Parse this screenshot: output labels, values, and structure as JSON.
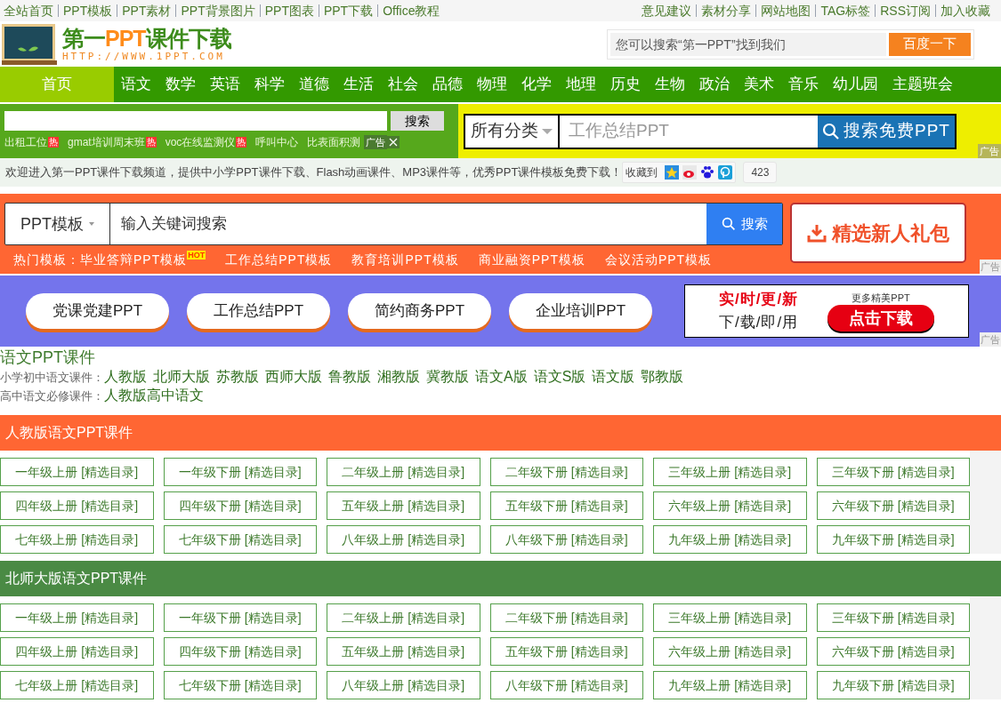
{
  "top_bar": {
    "left_links": [
      "全站首页",
      "PPT模板",
      "PPT素材",
      "PPT背景图片",
      "PPT图表",
      "PPT下载",
      "Office教程"
    ],
    "right_links": [
      "意见建议",
      "素材分享",
      "网站地图",
      "TAG标签",
      "RSS订阅",
      "加入收藏"
    ]
  },
  "header": {
    "logo_title_parts": [
      "第一",
      "PPT",
      "课件下载"
    ],
    "logo_url": "HTTP://WWW.1PPT.COM",
    "search_placeholder": "您可以搜索“第一PPT”找到我们",
    "search_button": "百度一下"
  },
  "nav": [
    {
      "label": "首页",
      "selected": true
    },
    {
      "label": "语文",
      "selected": false
    },
    {
      "label": "数学",
      "selected": false
    },
    {
      "label": "英语",
      "selected": false
    },
    {
      "label": "科学",
      "selected": false
    },
    {
      "label": "道德",
      "selected": false
    },
    {
      "label": "生活",
      "selected": false
    },
    {
      "label": "社会",
      "selected": false
    },
    {
      "label": "品德",
      "selected": false
    },
    {
      "label": "物理",
      "selected": false
    },
    {
      "label": "化学",
      "selected": false
    },
    {
      "label": "地理",
      "selected": false
    },
    {
      "label": "历史",
      "selected": false
    },
    {
      "label": "生物",
      "selected": false
    },
    {
      "label": "政治",
      "selected": false
    },
    {
      "label": "美术",
      "selected": false
    },
    {
      "label": "音乐",
      "selected": false
    },
    {
      "label": "幼儿园",
      "selected": false
    },
    {
      "label": "主题班会",
      "selected": false
    }
  ],
  "ad_left": {
    "search_button": "搜索",
    "links": [
      {
        "label": "出租工位",
        "badge": "热"
      },
      {
        "label": "gmat培训周末班",
        "badge": "热"
      },
      {
        "label": "voc在线监测仪",
        "badge": "热"
      },
      {
        "label": "呼叫中心"
      },
      {
        "label": "比表面积测"
      }
    ],
    "ad_label": "广告"
  },
  "ad_right": {
    "category": "所有分类",
    "placeholder": "工作总结PPT",
    "button": "搜索免费PPT",
    "ad_label": "广告"
  },
  "welcome": {
    "text": "欢迎进入第一PPT课件下载频道，提供中小学PPT课件下载、Flash动画课件、MP3课件等，优秀PPT课件模板免费下载！",
    "bookmark_label": "收藏到",
    "count": "423"
  },
  "template_banner": {
    "category": "PPT模板",
    "placeholder": "输入关键词搜索",
    "button": "搜索",
    "gift_button": "精选新人礼包",
    "hot_label": "热门模板：",
    "hot_links": [
      {
        "label": "毕业答辩PPT模板",
        "badge": "HOT"
      },
      {
        "label": "工作总结PPT模板"
      },
      {
        "label": "教育培训PPT模板"
      },
      {
        "label": "商业融资PPT模板"
      },
      {
        "label": "会议活动PPT模板"
      }
    ],
    "ad_label": "广告"
  },
  "promo_banner": {
    "pills": [
      "党课党建PPT",
      "工作总结PPT",
      "简约商务PPT",
      "企业培训PPT"
    ],
    "slogan_top": "实/时/更/新",
    "slogan_bottom": "下/载/即/用",
    "more_label": "更多精美PPT",
    "download_button": "点击下载",
    "ad_label": "广告"
  },
  "subject": {
    "title": "语文PPT课件",
    "rows": [
      {
        "label": "小学初中语文课件：",
        "links": [
          "人教版",
          "北师大版",
          "苏教版",
          "西师大版",
          "鲁教版",
          "湘教版",
          "冀教版",
          "语文A版",
          "语文S版",
          "语文版",
          "鄂教版"
        ]
      },
      {
        "label": "高中语文必修课件：",
        "links": [
          "人教版高中语文"
        ]
      }
    ]
  },
  "sections": [
    {
      "title": "人教版语文PPT课件",
      "color": "#ff6633",
      "items": [
        "一年级上册 [精选目录]",
        "一年级下册 [精选目录]",
        "二年级上册 [精选目录]",
        "二年级下册 [精选目录]",
        "三年级上册 [精选目录]",
        "三年级下册 [精选目录]",
        "四年级上册 [精选目录]",
        "四年级下册 [精选目录]",
        "五年级上册 [精选目录]",
        "五年级下册 [精选目录]",
        "六年级上册 [精选目录]",
        "六年级下册 [精选目录]",
        "七年级上册 [精选目录]",
        "七年级下册 [精选目录]",
        "八年级上册 [精选目录]",
        "八年级下册 [精选目录]",
        "九年级上册 [精选目录]",
        "九年级下册 [精选目录]"
      ]
    },
    {
      "title": "北师大版语文PPT课件",
      "color": "#4a8a44",
      "items": [
        "一年级上册 [精选目录]",
        "一年级下册 [精选目录]",
        "二年级上册 [精选目录]",
        "二年级下册 [精选目录]",
        "三年级上册 [精选目录]",
        "三年级下册 [精选目录]",
        "四年级上册 [精选目录]",
        "四年级下册 [精选目录]",
        "五年级上册 [精选目录]",
        "五年级下册 [精选目录]",
        "六年级上册 [精选目录]",
        "六年级下册 [精选目录]",
        "七年级上册 [精选目录]",
        "七年级下册 [精选目录]",
        "八年级上册 [精选目录]",
        "八年级下册 [精选目录]",
        "九年级上册 [精选目录]",
        "九年级下册 [精选目录]"
      ]
    }
  ]
}
